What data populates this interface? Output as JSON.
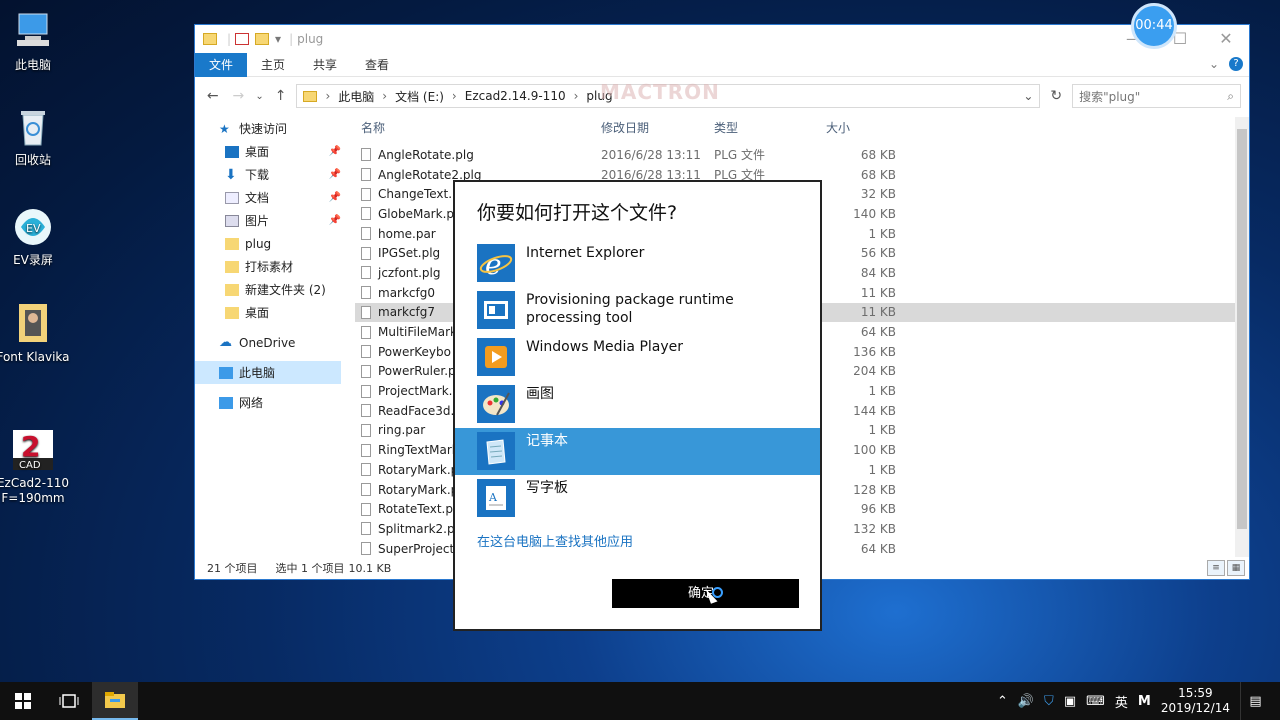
{
  "timer": "00:44",
  "watermark": "MACTRON",
  "desktop": [
    {
      "label": "此电脑"
    },
    {
      "label": "回收站"
    },
    {
      "label": "EV录屏"
    },
    {
      "label": "Font Klavika"
    },
    {
      "label": "EzCad2-110\nF=190mm"
    }
  ],
  "explorer": {
    "title": "plug",
    "tabs": [
      "文件",
      "主页",
      "共享",
      "查看"
    ],
    "breadcrumb": [
      "此电脑",
      "文档 (E:)",
      "Ezcad2.14.9-110",
      "plug"
    ],
    "search_placeholder": "搜索\"plug\"",
    "nav": [
      {
        "label": "快速访问",
        "pinned": false
      },
      {
        "label": "桌面",
        "pinned": true
      },
      {
        "label": "下载",
        "pinned": true
      },
      {
        "label": "文档",
        "pinned": true
      },
      {
        "label": "图片",
        "pinned": true
      },
      {
        "label": "plug",
        "pinned": false
      },
      {
        "label": "打标素材",
        "pinned": false
      },
      {
        "label": "新建文件夹 (2)",
        "pinned": false
      },
      {
        "label": "桌面",
        "pinned": false
      },
      {
        "label": "OneDrive",
        "pinned": false
      },
      {
        "label": "此电脑",
        "pinned": false
      },
      {
        "label": "网络",
        "pinned": false
      }
    ],
    "columns": [
      "名称",
      "修改日期",
      "类型",
      "大小"
    ],
    "files": [
      {
        "name": "AngleRotate.plg",
        "date": "2016/6/28 13:11",
        "type": "PLG 文件",
        "size": "68 KB"
      },
      {
        "name": "AngleRotate2.plg",
        "date": "2016/6/28 13:11",
        "type": "PLG 文件",
        "size": "68 KB"
      },
      {
        "name": "ChangeText.p",
        "date": "",
        "type": "",
        "size": "32 KB"
      },
      {
        "name": "GlobeMark.p",
        "date": "",
        "type": "",
        "size": "140 KB"
      },
      {
        "name": "home.par",
        "date": "",
        "type": "",
        "size": "1 KB"
      },
      {
        "name": "IPGSet.plg",
        "date": "",
        "type": "",
        "size": "56 KB"
      },
      {
        "name": "jczfont.plg",
        "date": "",
        "type": "",
        "size": "84 KB"
      },
      {
        "name": "markcfg0",
        "date": "",
        "type": "",
        "size": "11 KB"
      },
      {
        "name": "markcfg7",
        "date": "",
        "type": "",
        "size": "11 KB"
      },
      {
        "name": "MultiFileMark",
        "date": "",
        "type": "",
        "size": "64 KB"
      },
      {
        "name": "PowerKeybo",
        "date": "",
        "type": "",
        "size": "136 KB"
      },
      {
        "name": "PowerRuler.p",
        "date": "",
        "type": "",
        "size": "204 KB"
      },
      {
        "name": "ProjectMark.p",
        "date": "",
        "type": "",
        "size": "1 KB"
      },
      {
        "name": "ReadFace3d.p",
        "date": "",
        "type": "",
        "size": "144 KB"
      },
      {
        "name": "ring.par",
        "date": "",
        "type": "",
        "size": "1 KB"
      },
      {
        "name": "RingTextMark",
        "date": "",
        "type": "",
        "size": "100 KB"
      },
      {
        "name": "RotaryMark.p",
        "date": "",
        "type": "",
        "size": "1 KB"
      },
      {
        "name": "RotaryMark.p",
        "date": "",
        "type": "",
        "size": "128 KB"
      },
      {
        "name": "RotateText.pl",
        "date": "",
        "type": "",
        "size": "96 KB"
      },
      {
        "name": "Splitmark2.pl",
        "date": "",
        "type": "",
        "size": "132 KB"
      },
      {
        "name": "SuperProject",
        "date": "",
        "type": "",
        "size": "64 KB"
      }
    ],
    "selected_file": "markcfg7",
    "status": {
      "count": "21 个项目",
      "selection": "选中 1 个项目",
      "size": "10.1 KB"
    }
  },
  "dialog": {
    "title": "你要如何打开这个文件?",
    "apps": [
      {
        "label": "Internet Explorer",
        "icon": "ie-icon"
      },
      {
        "label": "Provisioning package runtime processing tool",
        "icon": "provisioning-icon"
      },
      {
        "label": "Windows Media Player",
        "icon": "media-player-icon"
      },
      {
        "label": "画图",
        "icon": "paint-icon"
      },
      {
        "label": "记事本",
        "icon": "notepad-icon"
      },
      {
        "label": "写字板",
        "icon": "wordpad-icon"
      }
    ],
    "selected_app": "记事本",
    "more_link": "在这台电脑上查找其他应用",
    "ok": "确定"
  },
  "taskbar": {
    "tray_lang": "英",
    "time": "15:59",
    "date": "2019/12/14"
  },
  "colors": {
    "accent": "#1979ca",
    "selection": "#3897d8"
  }
}
